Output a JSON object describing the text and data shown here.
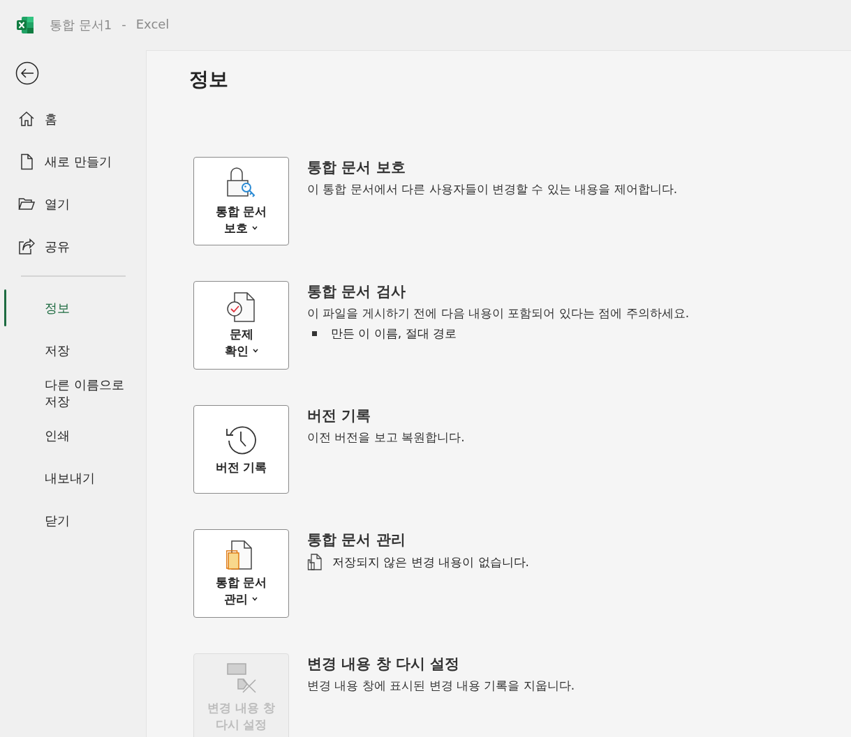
{
  "window": {
    "document_title": "통합 문서1",
    "separator": "-",
    "app_name": "Excel"
  },
  "sidebar": {
    "items": [
      {
        "label": "홈",
        "kind": "icon",
        "selected": false
      },
      {
        "label": "새로 만들기",
        "kind": "icon",
        "selected": false
      },
      {
        "label": "열기",
        "kind": "icon",
        "selected": false
      },
      {
        "label": "공유",
        "kind": "icon",
        "selected": false
      },
      {
        "label": "정보",
        "kind": "plain",
        "selected": true
      },
      {
        "label": "저장",
        "kind": "plain",
        "selected": false
      },
      {
        "label": "다른 이름으로 저장",
        "kind": "plain",
        "selected": false
      },
      {
        "label": "인쇄",
        "kind": "plain",
        "selected": false
      },
      {
        "label": "내보내기",
        "kind": "plain",
        "selected": false
      },
      {
        "label": "닫기",
        "kind": "plain",
        "selected": false
      }
    ]
  },
  "page": {
    "heading": "정보",
    "sections": [
      {
        "button": {
          "label_lines": [
            "통합 문서",
            "보호"
          ],
          "dropdown": true,
          "disabled": false
        },
        "title": "통합 문서 보호",
        "description": "이 통합 문서에서 다른 사용자들이 변경할 수 있는 내용을 제어합니다."
      },
      {
        "button": {
          "label_lines": [
            "문제",
            "확인"
          ],
          "dropdown": true,
          "disabled": false
        },
        "title": "통합 문서 검사",
        "description": "이 파일을 게시하기 전에 다음 내용이 포함되어 있다는 점에 주의하세요.",
        "bullets": [
          "만든 이 이름, 절대 경로"
        ]
      },
      {
        "button": {
          "label_lines": [
            "버전 기록"
          ],
          "dropdown": false,
          "disabled": false
        },
        "title": "버전 기록",
        "description": "이전 버전을 보고 복원합니다."
      },
      {
        "button": {
          "label_lines": [
            "통합 문서",
            "관리"
          ],
          "dropdown": true,
          "disabled": false
        },
        "title": "통합 문서 관리",
        "note": "저장되지 않은 변경 내용이 없습니다."
      },
      {
        "button": {
          "label_lines": [
            "변경 내용 창",
            "다시 설정"
          ],
          "dropdown": false,
          "disabled": true
        },
        "title": "변경 내용 창 다시 설정",
        "description": "변경 내용 창에 표시된 변경 내용 기록을 지웁니다."
      }
    ]
  }
}
